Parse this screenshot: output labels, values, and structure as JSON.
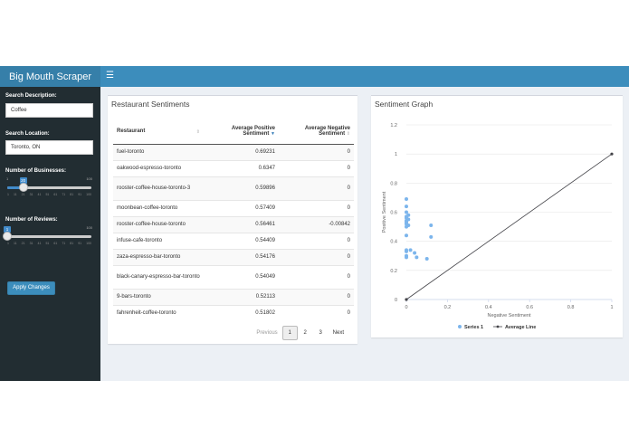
{
  "header": {
    "title": "Big Mouth Scraper",
    "menu_icon": "hamburger-icon"
  },
  "sidebar": {
    "search_description": {
      "label": "Search Description:",
      "value": "Coffee"
    },
    "search_location": {
      "label": "Search Location:",
      "value": "Toronto, ON"
    },
    "num_businesses": {
      "label": "Number of Businesses:",
      "min": "1",
      "max": "100",
      "value": "20",
      "fraction": 0.19,
      "ticks": [
        "1",
        "11",
        "21",
        "31",
        "41",
        "51",
        "61",
        "71",
        "81",
        "91",
        "100"
      ]
    },
    "num_reviews": {
      "label": "Number of Reviews:",
      "min": "1",
      "max": "100",
      "value": "1",
      "fraction": 0.0,
      "ticks": [
        "1",
        "11",
        "21",
        "31",
        "41",
        "51",
        "61",
        "71",
        "81",
        "91",
        "100"
      ]
    },
    "apply_label": "Apply Changes"
  },
  "table_box": {
    "title": "Restaurant Sentiments",
    "columns": [
      "Restaurant",
      "Average Positive Sentiment",
      "Average Negative Sentiment"
    ],
    "rows": [
      [
        "fuel-toronto",
        "0.69231",
        "0"
      ],
      [
        "oakwood-espresso-toronto",
        "0.6347",
        "0"
      ],
      [
        "rooster-coffee-house-toronto-3",
        "0.59896",
        "0"
      ],
      [
        "moonbean-coffee-toronto",
        "0.57409",
        "0"
      ],
      [
        "rooster-coffee-house-toronto",
        "0.56461",
        "-0.00842"
      ],
      [
        "infuse-cafe-toronto",
        "0.54409",
        "0"
      ],
      [
        "zaza-espresso-bar-toronto",
        "0.54176",
        "0"
      ],
      [
        "black-canary-espresso-bar-toronto",
        "0.54049",
        "0"
      ],
      [
        "9-bars-toronto",
        "0.52113",
        "0"
      ],
      [
        "fahrenheit-coffee-toronto",
        "0.51802",
        "0"
      ]
    ],
    "pagination": {
      "previous": "Previous",
      "pages": [
        "1",
        "2",
        "3"
      ],
      "current": "1",
      "next": "Next"
    }
  },
  "graph_box": {
    "title": "Sentiment Graph"
  },
  "chart_data": {
    "type": "scatter",
    "xlabel": "Negative Sentiment",
    "ylabel": "Positive Sentiment",
    "xlim": [
      0,
      1
    ],
    "ylim": [
      0,
      1.2
    ],
    "xticks": [
      "0",
      "0.2",
      "0.4",
      "0.6",
      "0.8",
      "1"
    ],
    "yticks": [
      "0",
      "0.2",
      "0.4",
      "0.6",
      "0.8",
      "1",
      "1.2"
    ],
    "grid": true,
    "legend_position": "bottom",
    "series": [
      {
        "name": "Series 1",
        "type": "scatter",
        "color": "#7cb5ec",
        "points": [
          [
            0,
            0.69
          ],
          [
            0,
            0.64
          ],
          [
            0,
            0.6
          ],
          [
            0,
            0.57
          ],
          [
            0,
            0.56
          ],
          [
            0,
            0.54
          ],
          [
            0,
            0.54
          ],
          [
            0,
            0.53
          ],
          [
            0,
            0.52
          ],
          [
            0,
            0.52
          ],
          [
            0,
            0.5
          ],
          [
            0,
            0.44
          ],
          [
            0,
            0.34
          ],
          [
            0,
            0.33
          ],
          [
            0,
            0.3
          ],
          [
            0,
            0.29
          ],
          [
            0.01,
            0.58
          ],
          [
            0.01,
            0.55
          ],
          [
            0.01,
            0.51
          ],
          [
            0.02,
            0.34
          ],
          [
            0.04,
            0.32
          ],
          [
            0.05,
            0.29
          ],
          [
            0.1,
            0.28
          ],
          [
            0.12,
            0.51
          ],
          [
            0.12,
            0.43
          ]
        ]
      },
      {
        "name": "Average Line",
        "type": "line",
        "color": "#434348",
        "points": [
          [
            0,
            0
          ],
          [
            1,
            1
          ]
        ]
      }
    ]
  }
}
